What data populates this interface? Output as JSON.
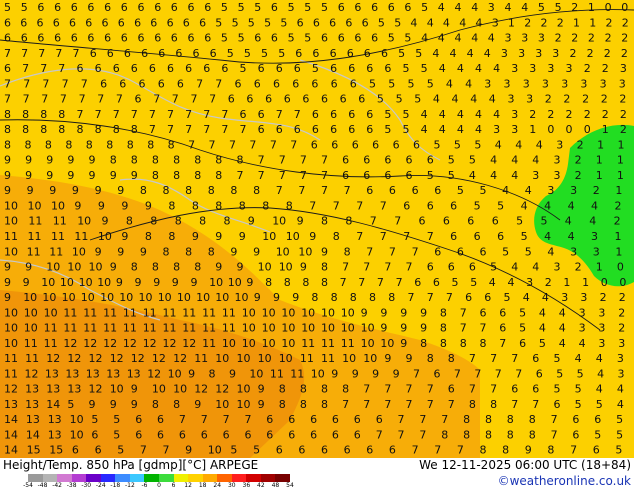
{
  "footer": {
    "title": "Height/Temp. 850 hPa [gdmp][°C] ARPEGE",
    "runtime": "We 12-11-2025 06:00 UTC (18+84)",
    "credit": "©weatheronline.co.uk"
  },
  "colorbar": {
    "tick_labels": [
      "-54",
      "-48",
      "-42",
      "-38",
      "-30",
      "-24",
      "-18",
      "-12",
      "-6",
      "0",
      "6",
      "12",
      "18",
      "24",
      "30",
      "36",
      "42",
      "48",
      "54"
    ],
    "colors": [
      "#9a9a9a",
      "#b4b4b4",
      "#d27ad2",
      "#b43cd2",
      "#6a00c8",
      "#2828ff",
      "#3c8cff",
      "#3cc8ff",
      "#00b400",
      "#3cdc3c",
      "#f0f000",
      "#ffd200",
      "#ffaa00",
      "#ff6400",
      "#ff1e1e",
      "#d20000",
      "#a00000",
      "#780000"
    ]
  },
  "map": {
    "background": "#fcd000",
    "warm_color": "#f5a40a",
    "green_color": "#22dd22",
    "number_color": "#111111",
    "contour_color": "#1a1a1a",
    "coast_color": "#c8c8c8",
    "rows": [
      "5 5 6 6 6 6 6 6 6 6 6 6 6 5 5 5 6 5 5 5 6 6 6 6 6 5 4 4 4 3 4 4 5 5 2 1 0 0",
      "6 6 6 6 6 6 6 6 6 6 6 6 6 5 5 5 5 5 6 6 6 6 6 5 5 4 4 4 4 4 3 1 2 2 2 1 1 2 2",
      "6 6 6 6 6 6 6 6 6 6 6 6 6 5 5 6 6 5 5 6 6 6 6 5 5 4 4 4 4 4 3 3 3 2 2 2 2 2",
      "7 7 7 7 7 6 6 6 6 6 6 6 6 5 5 5 5 6 6 6 6 6 6 5 5 4 4 4 4 3 3 3 3 2 2 2 2",
      "6 7 7 7 6 6 6 6 6 6 6 6 6 5 6 6 6 5 6 6 6 6 5 5 4 4 4 4 3 3 3 3 2 2 3",
      "7 7 7 7 7 6 6 6 6 6 7 7 6 6 6 6 6 6 6 5 5 5 5 4 4 3 3 3 3 3 3 3 3",
      "7 7 7 7 7 7 7 6 7 7 7 7 6 6 6 6 6 6 6 6 5 5 5 4 4 4 4 3 3 2 2 2 2 2",
      "8 8 8 8 7 7 7 7 7 7 7 7 7 6 6 7 7 6 6 6 6 5 5 4 4 4 4 4 3 2 2 2 2 2 2",
      "8 8 8 8 8 8 8 8 7 7 7 7 7 7 6 6 6 6 6 6 6 5 5 4 4 4 4 3 3 1 0 0 0 1 2",
      "8 8 8 8 8 8 8 8 8 7 7 7 7 7 7 6 6 6 6 6 6 5 5 5 4 4 4 3 2 1 1",
      "9 9 9 9 9 8 8 8 8 8 8 8 7 7 7 7 6 6 6 6 6 5 5 4 4 4 3 2 1 1",
      "9 9 9 9 9 9 9 8 8 8 8 7 7 7 7 7 6 6 6 6 5 5 4 4 4 3 3 2 1 1",
      "9 9 9 9 9 9 8 8 8 8 8 8 7 7 7 7 6 6 6 6 5 5 4 4 3 3 2 1",
      "10 10 10 9 9 9 9 8 8 8 8 8 8 7 7 7 7 6 6 6 5 5 4 4 4 4 2",
      "10 11 11 10 9 8 8 8 8 8 9 10 9 8 8 7 7 6 6 6 6 5 5 4 4 2",
      "11 11 11 11 10 9 8 8 9 9 9 10 10 9 8 7 7 7 7 6 6 6 5 4 4 3 1",
      "10 11 11 10 9 9 9 8 8 8 9 9 10 10 9 8 7 7 7 6 6 6 5 5 4 3 3 1",
      "9 9 10 10 10 9 8 8 8 8 9 9 10 10 9 8 7 7 7 7 6 6 6 5 4 4 3 2 1 0",
      "9 9 10 10 10 10 9 9 9 9 9 10 10 9 8 8 8 8 7 7 7 7 6 6 5 5 4 4 3 2 1 1 0 0",
      "9 10 10 10 10 10 10 10 10 10 10 10 10 9 9 9 8 8 8 8 8 7 7 7 6 6 5 4 4 3 3 2 2",
      "10 10 10 11 11 11 11 11 11 11 11 11 10 10 10 10 10 10 9 9 9 9 8 7 6 6 5 4 4 3 3 2",
      "10 10 11 11 11 11 11 11 11 11 11 11 10 10 10 10 10 10 10 9 9 9 8 7 7 6 5 4 4 3 3 2",
      "10 11 11 12 12 12 12 12 12 12 11 10 10 10 10 11 11 11 10 10 9 8 8 8 8 7 6 5 4 4 3 3",
      "11 11 12 12 12 12 12 12 12 11 10 10 10 10 11 11 10 10 9 9 8 8 7 7 7 6 5 4 4 3",
      "11 12 13 13 13 13 13 12 10 9 8 9 10 11 11 10 9 9 9 9 7 6 7 7 7 7 6 5 5 4 3",
      "12 13 13 13 12 10 9 10 10 12 12 10 9 8 8 8 8 7 7 7 7 6 7 7 6 6 5 5 4 4",
      "13 13 14 5 9 9 9 8 8 9 10 10 9 8 8 8 7 7 7 7 7 7 8 8 7 7 6 5 5 4",
      "14 13 13 10 5 5 6 6 7 7 7 7 6 6 6 6 6 6 7 7 7 8 8 8 8 7 6 6 5",
      "14 14 13 10 6 5 6 6 6 6 6 6 6 6 6 6 6 7 7 7 8 8 8 8 8 7 6 5 5",
      "14 15 15 6 6 5 7 7 9 10 5 5 6 6 6 6 6 6 7 7 7 8 8 9 8 7 6 5"
    ]
  }
}
